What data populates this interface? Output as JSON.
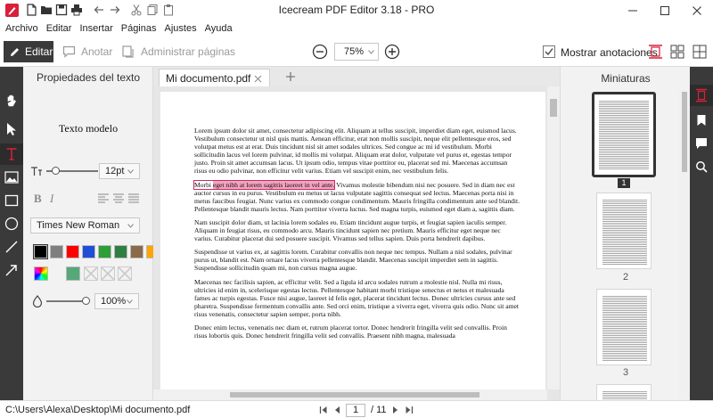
{
  "window": {
    "title": "Icecream PDF Editor 3.18 - PRO"
  },
  "menu": [
    "Archivo",
    "Editar",
    "Insertar",
    "Páginas",
    "Ajustes",
    "Ayuda"
  ],
  "toolbar": {
    "edit_label": "Editar",
    "annotate_label": "Anotar",
    "manage_pages_label": "Administrar páginas",
    "zoom_value": "75%",
    "show_annotations_label": "Mostrar anotaciones"
  },
  "properties": {
    "title": "Propiedades del texto",
    "sample": "Texto modelo",
    "font_size": "12pt",
    "font_family": "Times New Roman",
    "opacity": "100%",
    "colors": [
      "#000000",
      "#7f7f7f",
      "#ff0000",
      "#1f4fd6",
      "#2e9e36",
      "#2f7f43",
      "#8a6a4a",
      "#ffa500"
    ],
    "custom_color": "#55a87a"
  },
  "tabs": {
    "doc_tab": "Mi documento.pdf"
  },
  "document": {
    "paragraphs": [
      "Lorem ipsum dolor sit amet, consectetur adipiscing elit. Aliquam at tellus suscipit, imperdiet diam eget, euismod lacus. Vestibulum consectetur ut nisl quis mattis. Aenean efficitur, erat non mollis suscipit, neque elit pellentesque eros, sed volutpat metus est at erat. Duis tincidunt nisl sit amet sodales ultrices. Sed congue ac mi id vestibulum. Morbi sollicitudin lacus vel lorem pulvinar, id mollis mi volutpat. Aliquam erat dolor, vulputate vel purus et, egestas tempor justo. Proin sit amet accumsan lacus. Ut ipsum odio, tempus vitae porttitor eu, placerat sed mi. Maecenas accumsan risus eu odio pulvinar, non efficitur velit varius. Etiam vel suscipit enim, nec vestibulum felis.",
      "Nam suscipit dolor diam, ut lacinia lorem sodales eu. Etiam tincidunt augue turpis, et feugiat sapien iaculis semper. Aliquam in feugiat risus, eu commodo arcu. Mauris tincidunt sapien nec pretium. Mauris efficitur eget neque nec varius. Curabitur placerat dui sed posuere suscipit. Vivamus sed tellus sapien. Duis porta hendrerit dapibus.",
      "Suspendisse ut varius ex, at sagittis lorem. Curabitur convallis non neque nec tempus. Nullam a nisl sodales, pulvinar purus ut, blandit est. Nam ornare lacus viverra pellentesque blandit. Maecenas suscipit imperdiet sem in sagittis. Suspendisse sollicitudin quam mi, non cursus magna augue.",
      "Maecenas nec facilisis sapien, ac efficitur velit. Sed a ligula id arcu sodales rutrum a molestie nisl. Nulla mi risus, ultricies id enim in, scelerisque egestas lectus. Pellentesque habitant morbi tristique senectus et netus et malesuada fames ac turpis egestas. Fusce nisi augue, laoreet id felis eget, placerat tincidunt lectus. Donec ultricies cursus ante sed pharetra. Suspendisse fermentum convallis ante. Sed orci enim, tristique a viverra eget, viverra quis odio. Nunc sit amet risus venenatis, consectetur sapien semper, porta nibh.",
      "Donec enim lectus, venenatis nec diam et, rutrum placerat tortor. Donec hendrerit fringilla velit sed convallis. Proin risus lobortis quis. Donec hendrerit fringilla velit sed convallis. Praesent nibh magna, malesuada"
    ],
    "p2_start": "Morbi ",
    "p2_highlight": "eget nibh at lorem sagittis laoreet in vel ante.",
    "p2_rest": " Vivamus molestie bibendum nisi nec posuere. Sed in diam nec est auctor cursus in eu purus. Vestibulum eu metus ut lacus vulputate sagittis consequat sed lectus. Maecenas porta nisi in metus faucibus feugiat. Nunc varius ex commodo congue condimentum. Mauris fringilla condimentum ante sed blandit. Pellentesque blandit mauris lectus. Nam porttitor viverra luctus. Sed magna turpis, euismod eget diam a, sagittis diam."
  },
  "thumbnails": {
    "title": "Miniaturas",
    "pages": [
      "1",
      "2",
      "3"
    ]
  },
  "status": {
    "path": "C:\\Users\\Alexa\\Desktop\\Mi documento.pdf",
    "current_page": "1",
    "total": "/ 11"
  }
}
